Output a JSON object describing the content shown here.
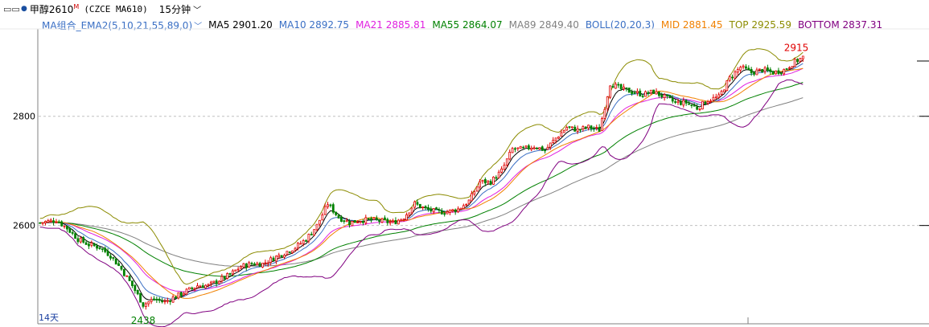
{
  "window": {
    "window_icon": "minimize-icon",
    "symbol_name": "甲醇2610",
    "superscript": "M",
    "contract_code": "(CZCE MA610)",
    "period": "15分钟",
    "period_dropdown_icon": "chevron-down-icon"
  },
  "legend": {
    "group_name": "MA组合_EMA2(5,10,21,55,89,0)",
    "ma5": "MA5 2901.20",
    "ma10": "MA10 2892.75",
    "ma21": "MA21 2885.81",
    "ma55": "MA55 2864.07",
    "ma89": "MA89 2849.40",
    "boll_name": "BOLL(20,20,3)",
    "mid": "MID 2881.45",
    "top": "TOP 2925.59",
    "bottom": "BOTTOM 2837.31"
  },
  "colors": {
    "legend_name": "#3a6fc4",
    "ma5": "#000000",
    "ma10": "#3a6fc4",
    "ma21": "#e020e0",
    "ma55": "#008000",
    "ma89": "#808080",
    "boll": "#3a6fc4",
    "mid": "#f08000",
    "top": "#8b8b00",
    "bottom": "#800080",
    "candle_up": "#e00000",
    "candle_down": "#008000",
    "grid": "#c0c0c0"
  },
  "annotations": {
    "high_label": "2915",
    "low_label": "2438",
    "days_label": "14天"
  },
  "chart_data": {
    "type": "candlestick",
    "y_ticks": [
      "2800",
      "2600"
    ],
    "ylim": [
      2420,
      2960
    ],
    "grid": "horizontal-dashed",
    "price_anchors": [
      [
        0,
        2605
      ],
      [
        6,
        2610
      ],
      [
        10,
        2595
      ],
      [
        14,
        2575
      ],
      [
        18,
        2565
      ],
      [
        22,
        2560
      ],
      [
        26,
        2545
      ],
      [
        30,
        2520
      ],
      [
        34,
        2490
      ],
      [
        38,
        2455
      ],
      [
        42,
        2465
      ],
      [
        46,
        2460
      ],
      [
        50,
        2470
      ],
      [
        54,
        2480
      ],
      [
        58,
        2490
      ],
      [
        62,
        2490
      ],
      [
        66,
        2500
      ],
      [
        70,
        2510
      ],
      [
        74,
        2525
      ],
      [
        78,
        2530
      ],
      [
        82,
        2530
      ],
      [
        86,
        2540
      ],
      [
        90,
        2550
      ],
      [
        94,
        2560
      ],
      [
        98,
        2575
      ],
      [
        102,
        2600
      ],
      [
        106,
        2640
      ],
      [
        110,
        2615
      ],
      [
        114,
        2605
      ],
      [
        118,
        2610
      ],
      [
        122,
        2610
      ],
      [
        126,
        2608
      ],
      [
        130,
        2605
      ],
      [
        134,
        2615
      ],
      [
        138,
        2640
      ],
      [
        142,
        2630
      ],
      [
        146,
        2625
      ],
      [
        150,
        2625
      ],
      [
        154,
        2630
      ],
      [
        158,
        2645
      ],
      [
        162,
        2680
      ],
      [
        166,
        2680
      ],
      [
        170,
        2700
      ],
      [
        174,
        2740
      ],
      [
        178,
        2740
      ],
      [
        182,
        2745
      ],
      [
        186,
        2738
      ],
      [
        190,
        2760
      ],
      [
        194,
        2780
      ],
      [
        198,
        2775
      ],
      [
        202,
        2780
      ],
      [
        206,
        2775
      ],
      [
        210,
        2860
      ],
      [
        214,
        2850
      ],
      [
        218,
        2845
      ],
      [
        222,
        2840
      ],
      [
        226,
        2845
      ],
      [
        230,
        2835
      ],
      [
        234,
        2825
      ],
      [
        238,
        2825
      ],
      [
        242,
        2815
      ],
      [
        246,
        2830
      ],
      [
        250,
        2835
      ],
      [
        254,
        2870
      ],
      [
        258,
        2890
      ],
      [
        262,
        2880
      ],
      [
        266,
        2885
      ],
      [
        270,
        2880
      ],
      [
        274,
        2885
      ],
      [
        278,
        2900
      ],
      [
        281,
        2908
      ]
    ],
    "candle_count": 282,
    "high": 2915,
    "low": 2438,
    "indicators": [
      {
        "name": "MA5",
        "last": 2901.2
      },
      {
        "name": "MA10",
        "last": 2892.75
      },
      {
        "name": "MA21",
        "last": 2885.81
      },
      {
        "name": "MA55",
        "last": 2864.07
      },
      {
        "name": "MA89",
        "last": 2849.4
      },
      {
        "name": "MID",
        "last": 2881.45
      },
      {
        "name": "TOP",
        "last": 2925.59
      },
      {
        "name": "BOTTOM",
        "last": 2837.31
      }
    ]
  }
}
